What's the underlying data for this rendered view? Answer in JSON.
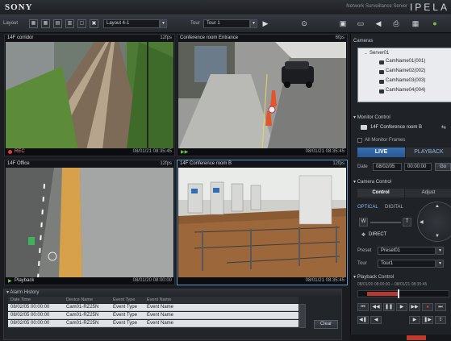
{
  "titlebar": {
    "brand": "SONY",
    "product": "Network Surveillance Server",
    "product_logo": "IPELA"
  },
  "toolbar": {
    "layout_label": "Layout",
    "layout_value": "Layout 4-1",
    "tour_label": "Tour",
    "tour_value": "Tour 1"
  },
  "panes": {
    "a": {
      "title": "14F corridor",
      "fps": "12fps",
      "status": "REC",
      "timestamp": "08/01/21 08:35:45"
    },
    "b": {
      "title": "Conference room Entrance",
      "fps": "6fps",
      "status": "",
      "timestamp": "08/01/21 08:35:45"
    },
    "c": {
      "title": "14F Office",
      "fps": "12fps",
      "status": "Playback",
      "timestamp": "08/01/20 08:00:00"
    },
    "d": {
      "title": "14F Conference room B",
      "fps": "12fps",
      "status": "",
      "timestamp": "08/01/21 08:35:45"
    }
  },
  "alarm": {
    "title": "Alarm History",
    "columns": [
      "Date Time",
      "Device Name",
      "Event Type",
      "Event Name"
    ],
    "rows": [
      [
        "08/02/05 00:00:00",
        "Cam01-RZ25N",
        "Event Type",
        "Event Name"
      ],
      [
        "08/02/05 00:00:00",
        "Cam01-RZ25N",
        "Event Type",
        "Event Name"
      ],
      [
        "08/02/05 00:00:00",
        "Cam01-RZ25N",
        "Event Type",
        "Event Name"
      ]
    ],
    "clear_label": "Clear"
  },
  "right": {
    "cameras_title": "Cameras",
    "server": "Server01",
    "cameras": [
      "CamName01(001)",
      "CamName02(002)",
      "CamName03(003)",
      "CamName04(004)"
    ],
    "monitor_title": "Monitor Control",
    "monitor_target": "14F Conference room B",
    "all_frames": "All Monitor Frames",
    "live_label": "LIVE",
    "playback_label": "PLAYBACK",
    "date_label": "Date",
    "date_value": "08/02/05",
    "time_value": "00:00:00",
    "camera_control_title": "Camera Control",
    "control_tab": "Control",
    "adjust_tab": "Adjust",
    "optical_tab": "OPTICAL",
    "digital_tab": "DIGITAL",
    "zoom_w": "W",
    "zoom_t": "T",
    "direct_label": "DIRECT",
    "preset_label": "Preset",
    "preset_value": "Preset01",
    "tour_label": "Tour",
    "tour_value": "Tour1",
    "playback_title": "Playback Control",
    "playback_range": "08/01/20 08:00:00 – 08/01/21 08:35:45"
  },
  "colors": {
    "accent": "#2f66a8",
    "rec": "#e23a2e",
    "selected_border": "#5f95c7"
  }
}
